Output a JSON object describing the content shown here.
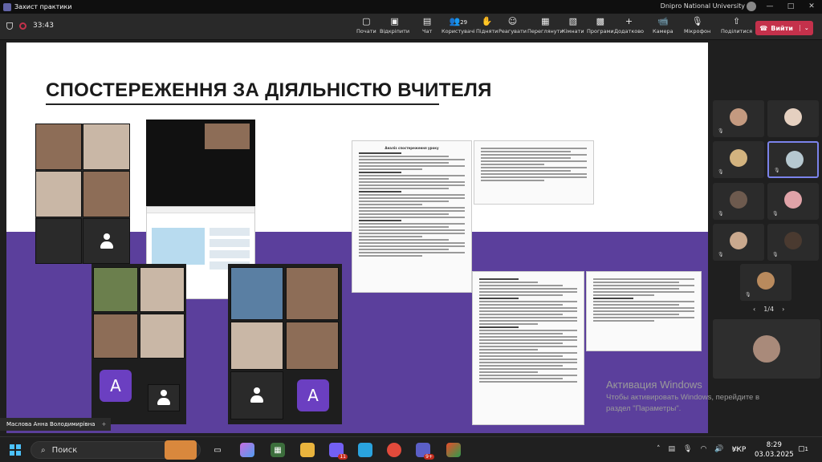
{
  "window": {
    "title": "Захист практики",
    "account": "Dnipro National University",
    "controls": [
      "—",
      "□",
      "✕"
    ]
  },
  "meeting": {
    "timer": "33:43"
  },
  "toolbar": {
    "items": [
      {
        "icon": "▢",
        "label": "Почати"
      },
      {
        "icon": "▣",
        "label": "Відкріпити"
      },
      {
        "icon": "▤",
        "label": "Чат"
      },
      {
        "icon": "👥",
        "label": "Користувачі",
        "badge": "29"
      },
      {
        "icon": "✋",
        "label": "Підняти"
      },
      {
        "icon": "☺",
        "label": "Реагувати"
      },
      {
        "icon": "▦",
        "label": "Переглянути"
      },
      {
        "icon": "▧",
        "label": "Кімнати"
      },
      {
        "icon": "▩",
        "label": "Програми"
      },
      {
        "icon": "+",
        "label": "Додатково"
      },
      {
        "icon": "📹",
        "label": "Камера"
      },
      {
        "icon": "🎙",
        "label": "Мікрофон"
      },
      {
        "icon": "⇧",
        "label": "Поділитися"
      }
    ],
    "leave_label": "Вийти"
  },
  "slide": {
    "heading": "СПОСТЕРЕЖЕННЯ ЗА ДІЯЛЬНІСТЮ ВЧИТЕЛЯ",
    "doc1_title": "Аналіз спостереження уроку",
    "avatar_letter": "A"
  },
  "presenter": {
    "name": "Маслова Анна Володимирівна",
    "plus": "+"
  },
  "gallery": {
    "page": "1/4",
    "prev": "‹",
    "next": "›"
  },
  "watermark": {
    "line1": "Активация Windows",
    "line2": "Чтобы активировать Windows, перейдите в",
    "line3": "раздел \"Параметры\"."
  },
  "taskbar": {
    "search_label": "Поиск",
    "badge_viber": "11",
    "badge_teams": "9+",
    "language": "УКР",
    "time": "8:29",
    "date": "03.03.2025",
    "notif_count": "1"
  }
}
